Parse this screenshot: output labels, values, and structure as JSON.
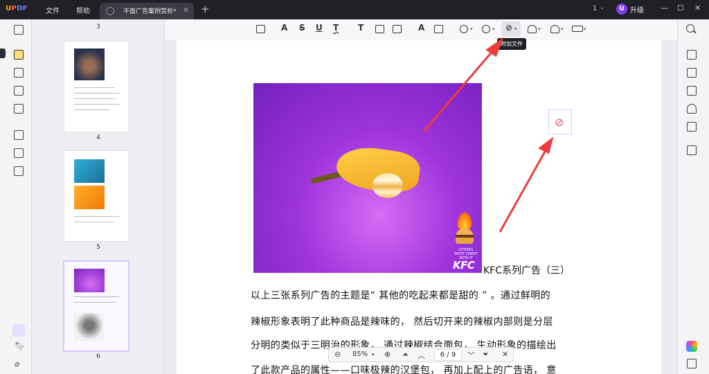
{
  "app": {
    "logo": "UPDF",
    "menu": [
      "文件",
      "帮助"
    ],
    "tab_title": "平面广告案例赏析*",
    "tab_close": "✕",
    "new_tab": "+",
    "page_selector": "1",
    "upgrade_avatar": "U",
    "upgrade_label": "升级",
    "window_controls": [
      "—",
      "☐",
      "✕"
    ]
  },
  "thumbnails": {
    "labels": [
      "3",
      "4",
      "5",
      "6"
    ],
    "active_page": "6"
  },
  "toolbar": {
    "tools": [
      "comment-icon",
      "highlight-icon",
      "strikethrough-icon",
      "underline-icon",
      "squiggly-icon",
      "text-icon",
      "textbox-icon",
      "text-callout-icon",
      "pencil-icon",
      "eraser-icon",
      "shape-icon",
      "sticker-icon",
      "attach-file-icon",
      "stamp-icon",
      "signature-icon",
      "measure-icon"
    ],
    "glyphs": {
      "highlight": "A",
      "strike": "S",
      "underline": "U",
      "squiggly": "T",
      "text": "T",
      "pencil": "A",
      "caret": "▾"
    },
    "tooltip": "附加文件"
  },
  "document": {
    "caption": "KFC系列广告（三）",
    "ad_kfc": "KFC",
    "ad_claim": "OTHERS TASTE SWEET WITH IT",
    "paragraph": [
      "以上三张系列广告的主题是“ 其他的吃起来都是甜的 ”    。通过鲜明的",
      "辣椒形象表明了此种商品是辣味的，    然后切开来的辣椒内部则是分层",
      "分明的类似于三明治的形象，    通过辣椒结合面包，    生动形象的描绘出",
      "了此款产品的属性——口味极辣的汉堡包，    再加上配上的广告语，    意"
    ],
    "attachment_icon": "📎"
  },
  "zoombar": {
    "zoom_out": "⊖",
    "zoom": "85%",
    "zoom_caret": "▾",
    "zoom_in": "⊕",
    "first": "⏶",
    "prev": "︿",
    "page": "6 / 9",
    "next": "﹀",
    "last": "⏷",
    "close": "✕"
  },
  "colors": {
    "accent": "#7b3ff2",
    "arrow": "#ee3b3b",
    "titlebar": "#202127"
  }
}
